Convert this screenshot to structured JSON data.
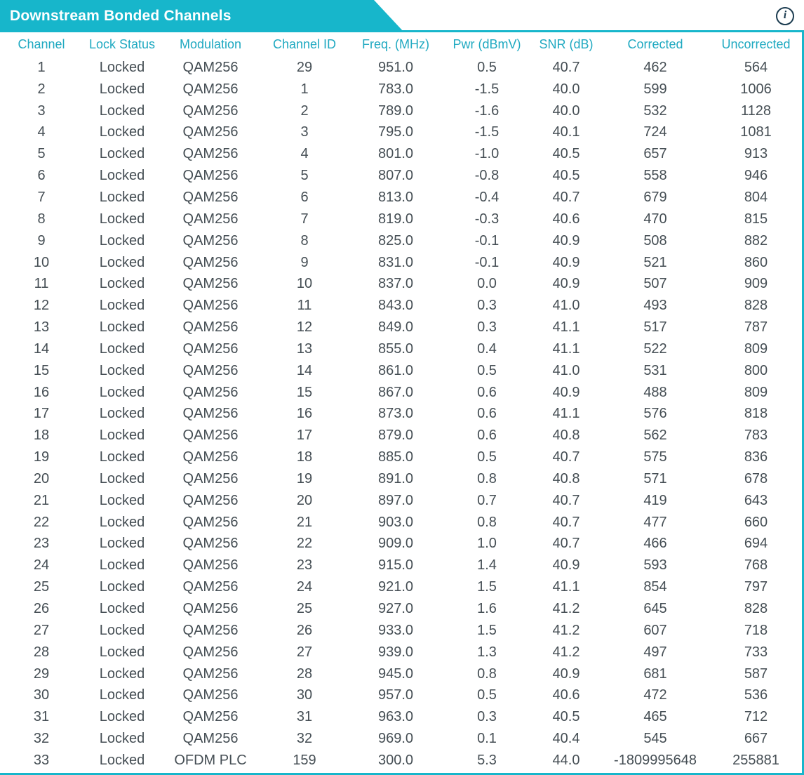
{
  "header": {
    "title": "Downstream Bonded Channels",
    "info_glyph": "i"
  },
  "colors": {
    "accent_cyan": "#17B6CB",
    "column_header_text": "#1FA9C1",
    "body_text": "#454E54",
    "banner_title_text": "#FFFFFF",
    "info_icon": "#1C3C50"
  },
  "table": {
    "columns": [
      "Channel",
      "Lock Status",
      "Modulation",
      "Channel ID",
      "Freq. (MHz)",
      "Pwr (dBmV)",
      "SNR (dB)",
      "Corrected",
      "Uncorrected"
    ],
    "rows": [
      [
        "1",
        "Locked",
        "QAM256",
        "29",
        "951.0",
        "0.5",
        "40.7",
        "462",
        "564"
      ],
      [
        "2",
        "Locked",
        "QAM256",
        "1",
        "783.0",
        "-1.5",
        "40.0",
        "599",
        "1006"
      ],
      [
        "3",
        "Locked",
        "QAM256",
        "2",
        "789.0",
        "-1.6",
        "40.0",
        "532",
        "1128"
      ],
      [
        "4",
        "Locked",
        "QAM256",
        "3",
        "795.0",
        "-1.5",
        "40.1",
        "724",
        "1081"
      ],
      [
        "5",
        "Locked",
        "QAM256",
        "4",
        "801.0",
        "-1.0",
        "40.5",
        "657",
        "913"
      ],
      [
        "6",
        "Locked",
        "QAM256",
        "5",
        "807.0",
        "-0.8",
        "40.5",
        "558",
        "946"
      ],
      [
        "7",
        "Locked",
        "QAM256",
        "6",
        "813.0",
        "-0.4",
        "40.7",
        "679",
        "804"
      ],
      [
        "8",
        "Locked",
        "QAM256",
        "7",
        "819.0",
        "-0.3",
        "40.6",
        "470",
        "815"
      ],
      [
        "9",
        "Locked",
        "QAM256",
        "8",
        "825.0",
        "-0.1",
        "40.9",
        "508",
        "882"
      ],
      [
        "10",
        "Locked",
        "QAM256",
        "9",
        "831.0",
        "-0.1",
        "40.9",
        "521",
        "860"
      ],
      [
        "11",
        "Locked",
        "QAM256",
        "10",
        "837.0",
        "0.0",
        "40.9",
        "507",
        "909"
      ],
      [
        "12",
        "Locked",
        "QAM256",
        "11",
        "843.0",
        "0.3",
        "41.0",
        "493",
        "828"
      ],
      [
        "13",
        "Locked",
        "QAM256",
        "12",
        "849.0",
        "0.3",
        "41.1",
        "517",
        "787"
      ],
      [
        "14",
        "Locked",
        "QAM256",
        "13",
        "855.0",
        "0.4",
        "41.1",
        "522",
        "809"
      ],
      [
        "15",
        "Locked",
        "QAM256",
        "14",
        "861.0",
        "0.5",
        "41.0",
        "531",
        "800"
      ],
      [
        "16",
        "Locked",
        "QAM256",
        "15",
        "867.0",
        "0.6",
        "40.9",
        "488",
        "809"
      ],
      [
        "17",
        "Locked",
        "QAM256",
        "16",
        "873.0",
        "0.6",
        "41.1",
        "576",
        "818"
      ],
      [
        "18",
        "Locked",
        "QAM256",
        "17",
        "879.0",
        "0.6",
        "40.8",
        "562",
        "783"
      ],
      [
        "19",
        "Locked",
        "QAM256",
        "18",
        "885.0",
        "0.5",
        "40.7",
        "575",
        "836"
      ],
      [
        "20",
        "Locked",
        "QAM256",
        "19",
        "891.0",
        "0.8",
        "40.8",
        "571",
        "678"
      ],
      [
        "21",
        "Locked",
        "QAM256",
        "20",
        "897.0",
        "0.7",
        "40.7",
        "419",
        "643"
      ],
      [
        "22",
        "Locked",
        "QAM256",
        "21",
        "903.0",
        "0.8",
        "40.7",
        "477",
        "660"
      ],
      [
        "23",
        "Locked",
        "QAM256",
        "22",
        "909.0",
        "1.0",
        "40.7",
        "466",
        "694"
      ],
      [
        "24",
        "Locked",
        "QAM256",
        "23",
        "915.0",
        "1.4",
        "40.9",
        "593",
        "768"
      ],
      [
        "25",
        "Locked",
        "QAM256",
        "24",
        "921.0",
        "1.5",
        "41.1",
        "854",
        "797"
      ],
      [
        "26",
        "Locked",
        "QAM256",
        "25",
        "927.0",
        "1.6",
        "41.2",
        "645",
        "828"
      ],
      [
        "27",
        "Locked",
        "QAM256",
        "26",
        "933.0",
        "1.5",
        "41.2",
        "607",
        "718"
      ],
      [
        "28",
        "Locked",
        "QAM256",
        "27",
        "939.0",
        "1.3",
        "41.2",
        "497",
        "733"
      ],
      [
        "29",
        "Locked",
        "QAM256",
        "28",
        "945.0",
        "0.8",
        "40.9",
        "681",
        "587"
      ],
      [
        "30",
        "Locked",
        "QAM256",
        "30",
        "957.0",
        "0.5",
        "40.6",
        "472",
        "536"
      ],
      [
        "31",
        "Locked",
        "QAM256",
        "31",
        "963.0",
        "0.3",
        "40.5",
        "465",
        "712"
      ],
      [
        "32",
        "Locked",
        "QAM256",
        "32",
        "969.0",
        "0.1",
        "40.4",
        "545",
        "667"
      ],
      [
        "33",
        "Locked",
        "OFDM PLC",
        "159",
        "300.0",
        "5.3",
        "44.0",
        "-1809995648",
        "255881"
      ]
    ]
  }
}
